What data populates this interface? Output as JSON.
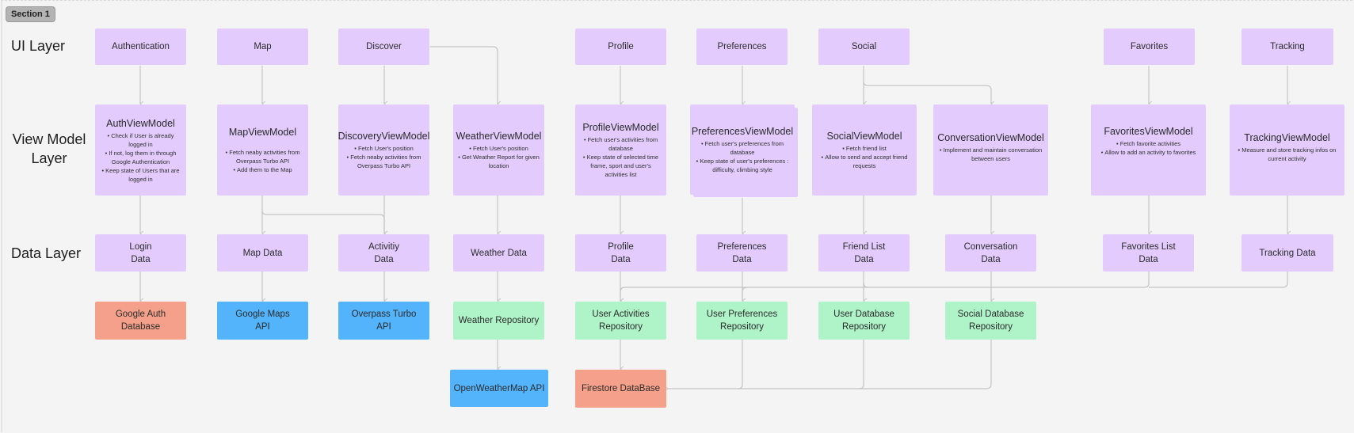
{
  "section": {
    "label": "Section 1"
  },
  "layers": {
    "ui": "UI Layer",
    "view_model": "View Model Layer",
    "data": "Data Layer"
  },
  "colors": {
    "ui_node": "#e3ccfd",
    "repository_node": "#aff3c9",
    "api_node": "#53b4fb",
    "database_node": "#f4a08a",
    "connector": "#c4c4c4"
  },
  "ui_nodes": {
    "authentication": "Authentication",
    "map": "Map",
    "discover": "Discover",
    "profile": "Profile",
    "preferences": "Preferences",
    "social": "Social",
    "favorites": "Favorites",
    "tracking": "Tracking"
  },
  "view_models": {
    "auth": {
      "title": "AuthViewModel",
      "items": [
        "Check if User is already logged in",
        "If not, log them in through Google Authentication",
        "Keep state of Users that are logged in"
      ]
    },
    "map": {
      "title": "MapViewModel",
      "items": [
        "Fetch neaby activities from Overpass Turbo API",
        "Add them to the Map"
      ]
    },
    "discovery": {
      "title": "DiscoveryViewModel",
      "items": [
        "Fetch User's position",
        "Fetch neaby activities from Overpass Turbo API"
      ]
    },
    "weather": {
      "title": "WeatherViewModel",
      "items": [
        "Fetch User's position",
        "Get Weather Report for given location"
      ]
    },
    "profile": {
      "title": "ProfileViewModel",
      "items": [
        "Fetch user's activities from database",
        "Keep state of selected time frame, sport and user's activities list"
      ]
    },
    "preferences": {
      "title": "PreferencesViewModel",
      "items": [
        "Fetch user's preferences from database",
        "Keep state of user's preferences : difficulty, climbing style"
      ]
    },
    "social": {
      "title": "SocialViewModel",
      "items": [
        "Fetch friend list",
        "Allow to send and accept friend requests"
      ]
    },
    "conversation": {
      "title": "ConversationViewModel",
      "items": [
        "Implement and maintain conversation between users"
      ]
    },
    "favorites": {
      "title": "FavoritesViewModel",
      "items": [
        "Fetch favorite activities",
        "Allow to add an activity to favorites"
      ]
    },
    "tracking": {
      "title": "TrackingViewModel",
      "items": [
        "Measure and store tracking infos on current activity"
      ]
    }
  },
  "data_nodes": {
    "login": [
      "Login",
      "Data"
    ],
    "map": [
      "Map Data"
    ],
    "activity": [
      "Activitiy",
      "Data"
    ],
    "weather": [
      "Weather Data"
    ],
    "profile": [
      "Profile",
      "Data"
    ],
    "preferences": [
      "Preferences",
      "Data"
    ],
    "friend_list": [
      "Friend List",
      "Data"
    ],
    "conversation": [
      "Conversation",
      "Data"
    ],
    "favorites_list": [
      "Favorites List",
      "Data"
    ],
    "tracking": [
      "Tracking Data"
    ]
  },
  "sources": {
    "google_auth": [
      "Google Auth",
      "Database"
    ],
    "google_maps": [
      "Google Maps",
      "API"
    ],
    "overpass": [
      "Overpass Turbo",
      "API"
    ],
    "weather_repo": [
      "Weather Repository"
    ],
    "user_activities_repo": [
      "User Activities",
      "Repository"
    ],
    "user_preferences_repo": [
      "User Preferences",
      "Repository"
    ],
    "user_database_repo": [
      "User Database",
      "Repository"
    ],
    "social_database_repo": [
      "Social Database",
      "Repository"
    ],
    "openweathermap": [
      "OpenWeatherMap API"
    ],
    "firestore": [
      "Firestore DataBase"
    ]
  }
}
